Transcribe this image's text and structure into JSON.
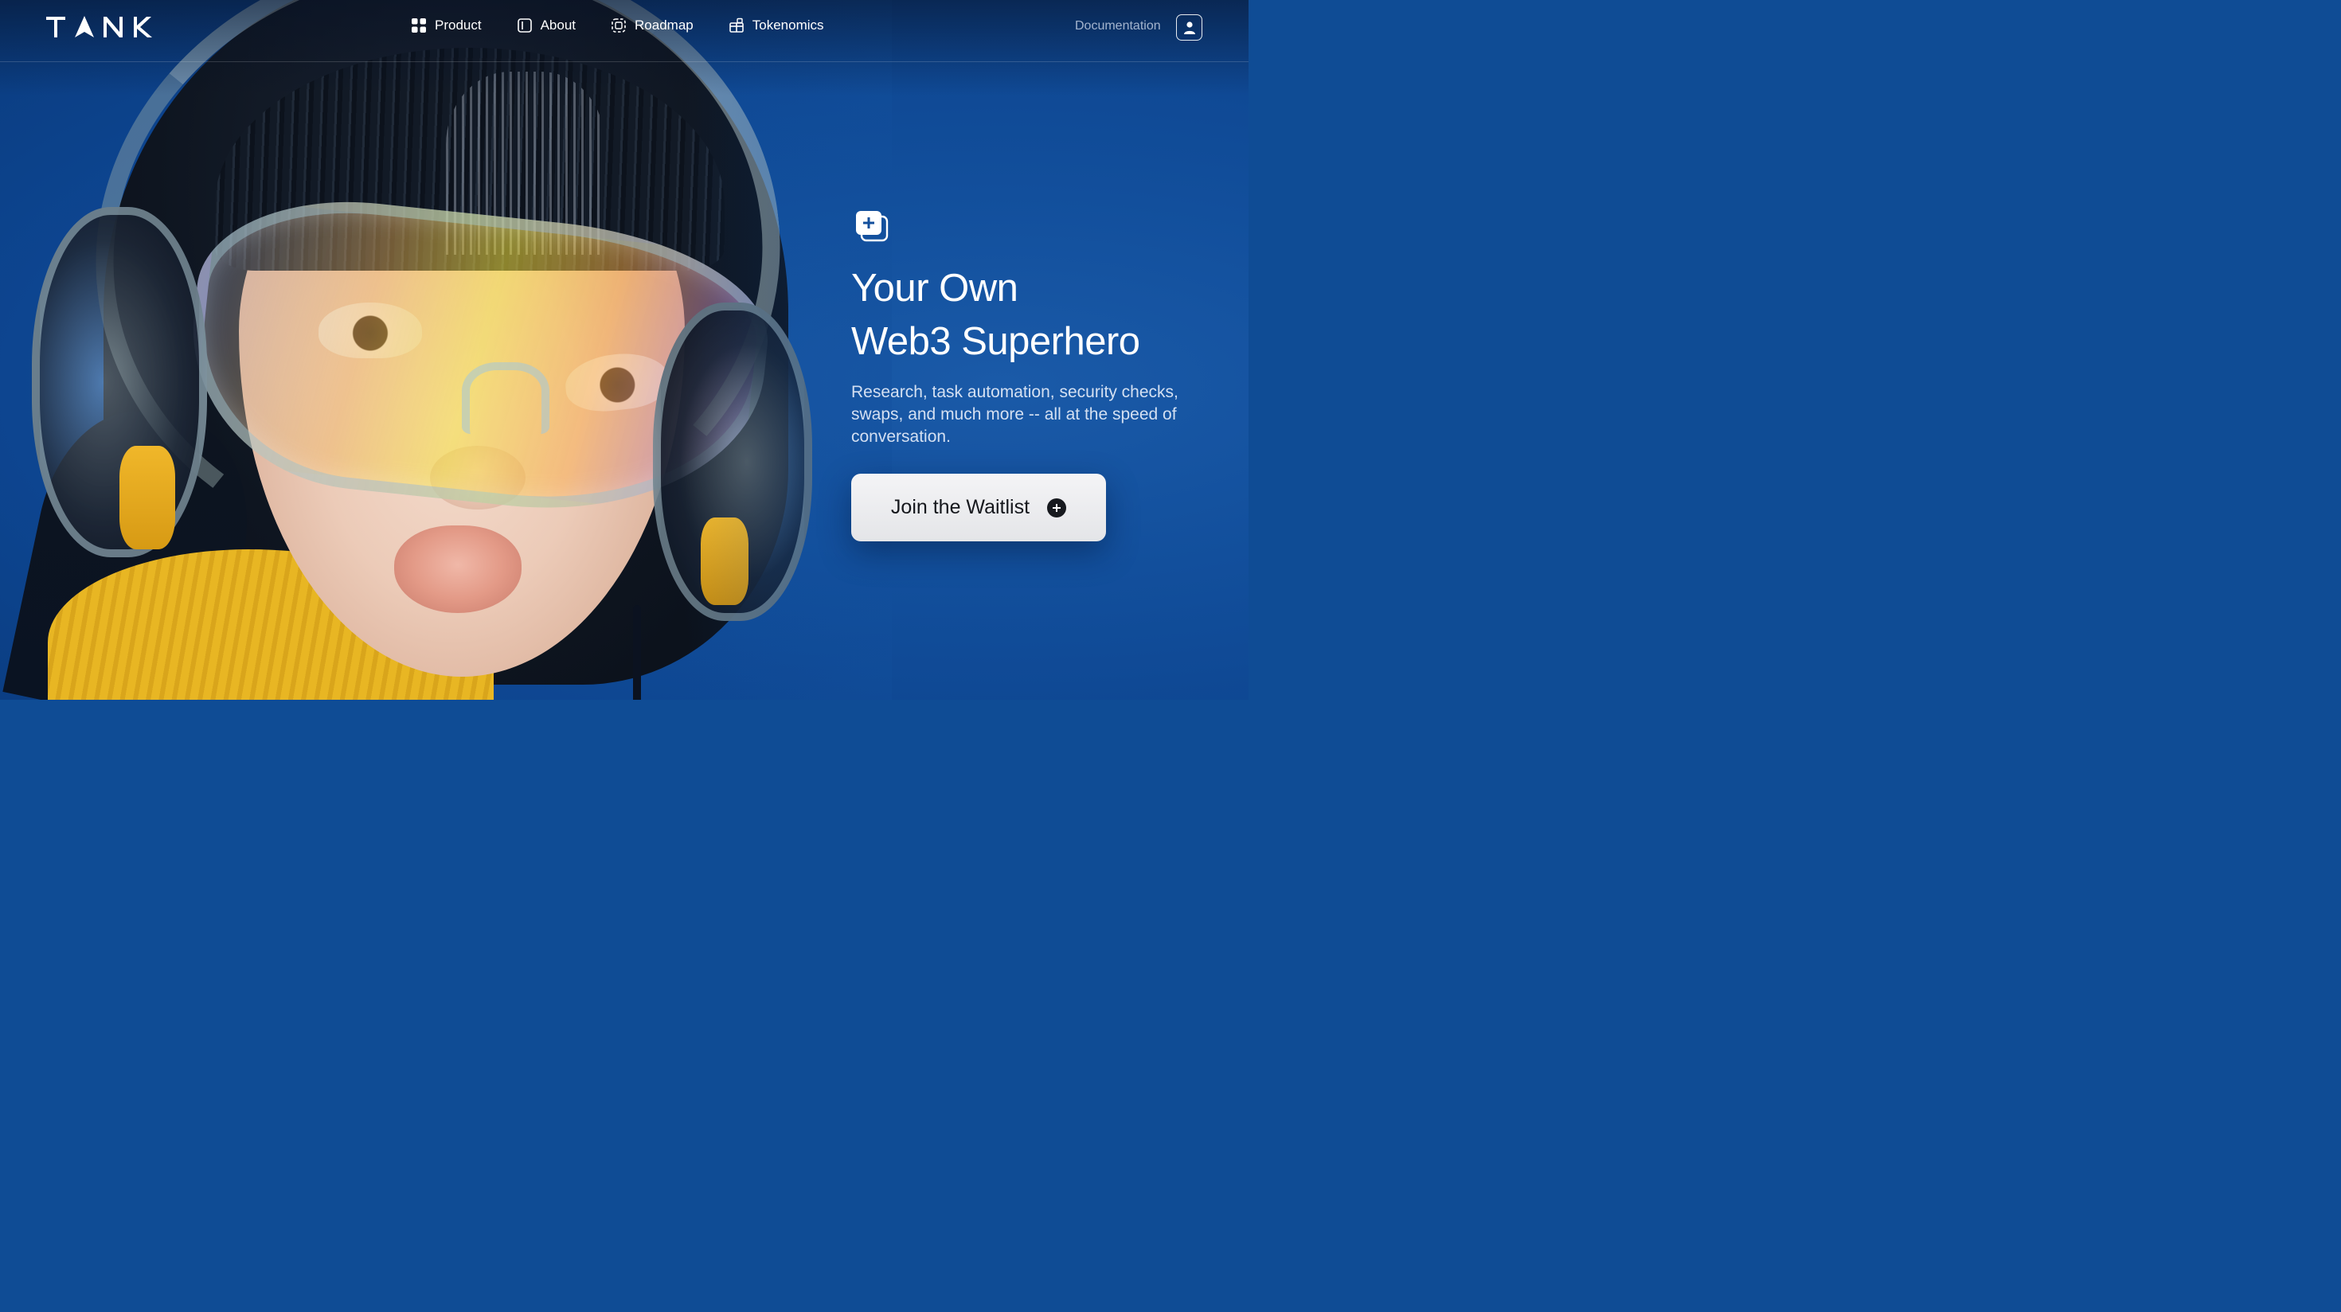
{
  "brand": {
    "logo_text": "TANK"
  },
  "nav": {
    "items": [
      {
        "label": "Product",
        "icon": "grid-icon"
      },
      {
        "label": "About",
        "icon": "sidebar-panel-icon"
      },
      {
        "label": "Roadmap",
        "icon": "dashed-square-icon"
      },
      {
        "label": "Tokenomics",
        "icon": "gift-box-icon"
      }
    ],
    "documentation_label": "Documentation",
    "account_icon": "user-icon"
  },
  "hero": {
    "badge_icon": "add-stack-icon",
    "title_line1": "Your Own",
    "title_line2": "Web3 Superhero",
    "subtitle": "Research, task automation, security checks, swaps, and much more -- all at the speed of conversation.",
    "cta_label": "Join the Waitlist",
    "cta_icon": "plus-circle-icon"
  },
  "colors": {
    "background": "#124f9c",
    "cta_background": "#eeeff1",
    "cta_text": "#15171c",
    "text_primary": "#ffffff"
  }
}
